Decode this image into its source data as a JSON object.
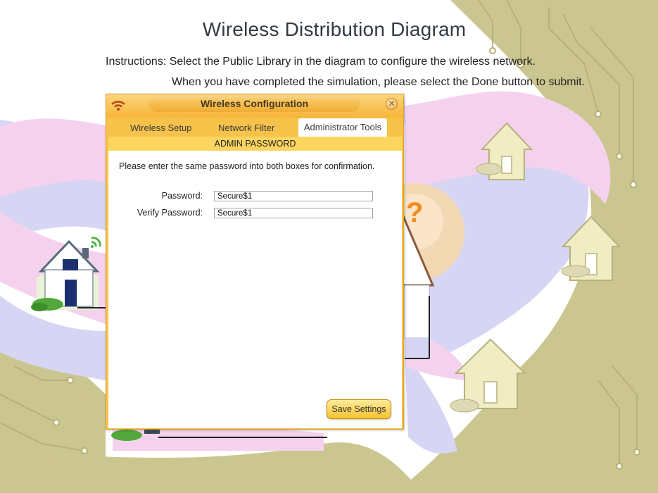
{
  "page": {
    "title": "Wireless Distribution Diagram",
    "instruction_line1": "Instructions: Select the Public Library in the diagram to configure the wireless network.",
    "instruction_line2": "When you have completed the simulation, please select the Done button to submit."
  },
  "dialog": {
    "title": "Wireless Configuration",
    "close_glyph": "✕",
    "tabs": [
      {
        "label": "Wireless Setup",
        "active": false
      },
      {
        "label": "Network Filter",
        "active": false
      },
      {
        "label": "Administrator Tools",
        "active": true
      }
    ],
    "section_title": "ADMIN PASSWORD",
    "prompt": "Please enter the same password into both boxes for confirmation.",
    "password": {
      "label": "Password:",
      "value": "Secure$1"
    },
    "verify_password": {
      "label": "Verify Password:",
      "value": "Secure$1"
    },
    "save_label": "Save Settings"
  },
  "diagram": {
    "question_mark": "?"
  },
  "colors": {
    "dialog_frame": "#f6c24a",
    "section_bar": "#fbd560",
    "pink_swirl": "#f3cfee",
    "lavender_swirl": "#d3d3f4",
    "olive_circuit": "#c9c48e",
    "house_fill": "#f2f0cf",
    "question_mark": "#f08a1c"
  }
}
